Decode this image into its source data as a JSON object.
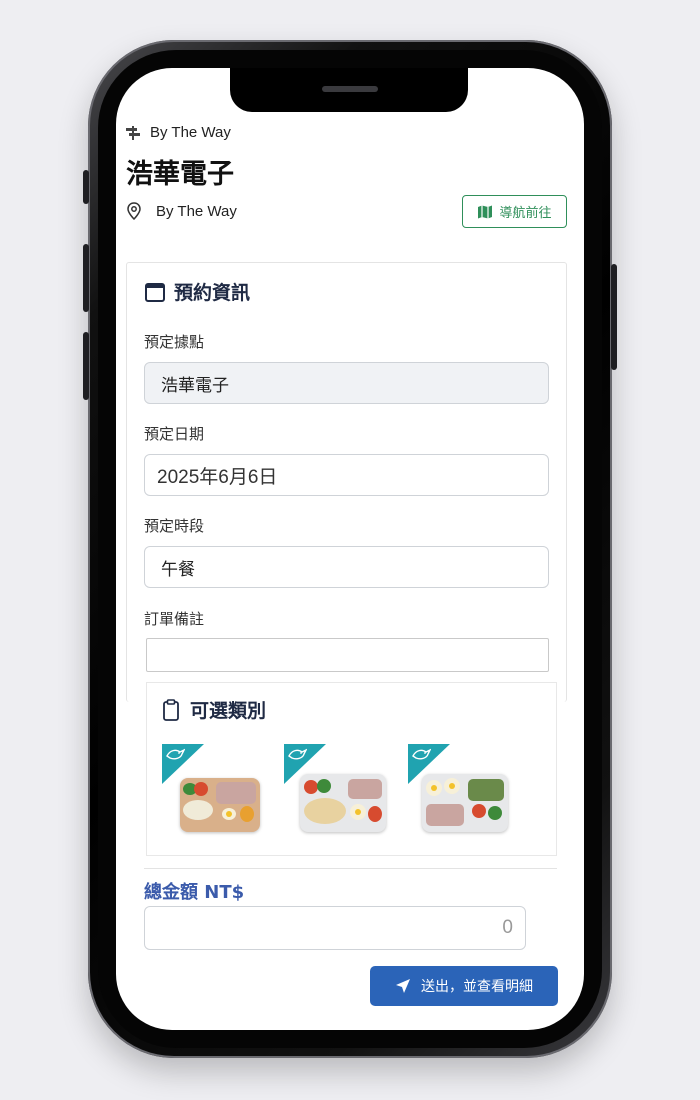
{
  "header": {
    "brand": "By The Way",
    "brand_icon": "signpost-icon",
    "store_name": "浩華電子",
    "location_icon": "map-pin-icon",
    "location_text": "By The Way",
    "nav_button_label": "導航前往",
    "nav_button_icon": "map-icon"
  },
  "booking": {
    "title": "預約資訊",
    "title_icon": "calendar-icon",
    "site_label": "預定據點",
    "site_value": "浩華電子",
    "date_label": "預定日期",
    "date_value": "2025年6月6日",
    "slot_label": "預定時段",
    "slot_value": "午餐",
    "note_label": "訂單備註",
    "note_value": ""
  },
  "categories": {
    "title": "可選類別",
    "title_icon": "clipboard-icon",
    "badge_icon": "bird-icon",
    "badge_color": "#20a3b0",
    "items": [
      {
        "icon": "lunchbox-image"
      },
      {
        "icon": "lunchbox-image"
      },
      {
        "icon": "lunchbox-image"
      }
    ]
  },
  "total": {
    "label": "總金額 NT$",
    "value": "0"
  },
  "submit": {
    "label": "送出，並查看明細",
    "icon": "send-arrow-icon",
    "color": "#2b64b8"
  }
}
